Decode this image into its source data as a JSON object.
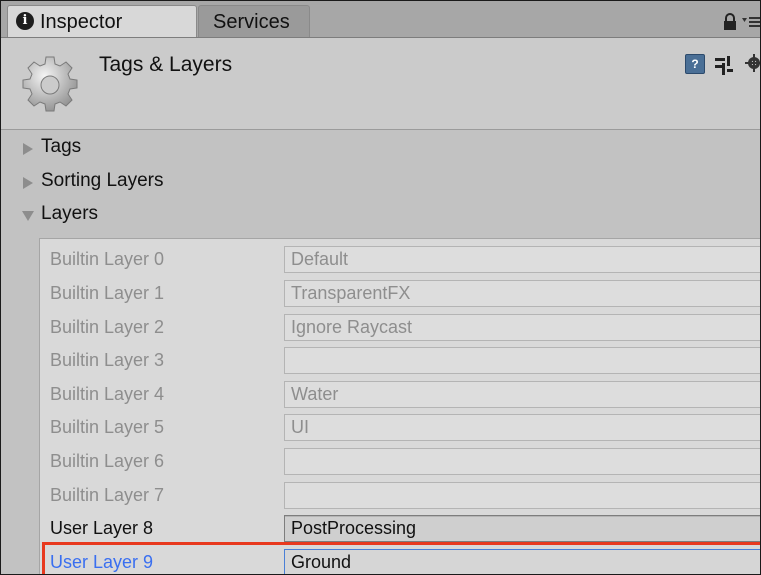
{
  "tabs": [
    {
      "label": "Inspector",
      "active": true
    },
    {
      "label": "Services",
      "active": false
    }
  ],
  "header": {
    "title": "Tags & Layers",
    "help_glyph": "?"
  },
  "foldouts": [
    {
      "label": "Tags",
      "expanded": false
    },
    {
      "label": "Sorting Layers",
      "expanded": false
    },
    {
      "label": "Layers",
      "expanded": true
    }
  ],
  "layers": [
    {
      "name": "Builtin Layer 0",
      "value": "Default"
    },
    {
      "name": "Builtin Layer 1",
      "value": "TransparentFX"
    },
    {
      "name": "Builtin Layer 2",
      "value": "Ignore Raycast"
    },
    {
      "name": "Builtin Layer 3",
      "value": ""
    },
    {
      "name": "Builtin Layer 4",
      "value": "Water"
    },
    {
      "name": "Builtin Layer 5",
      "value": "UI"
    },
    {
      "name": "Builtin Layer 6",
      "value": ""
    },
    {
      "name": "Builtin Layer 7",
      "value": ""
    },
    {
      "name": "User Layer 8",
      "value": "PostProcessing"
    },
    {
      "name": "User Layer 9",
      "value": "Ground"
    }
  ],
  "colors": {
    "highlight": "#e8391e",
    "selected_label": "#3a6ff0"
  },
  "icons": [
    "info-icon",
    "lock-icon",
    "menu-icon",
    "gear-icon",
    "help-icon",
    "preset-icon",
    "settings-icon",
    "triangle-right-icon",
    "triangle-down-icon"
  ]
}
